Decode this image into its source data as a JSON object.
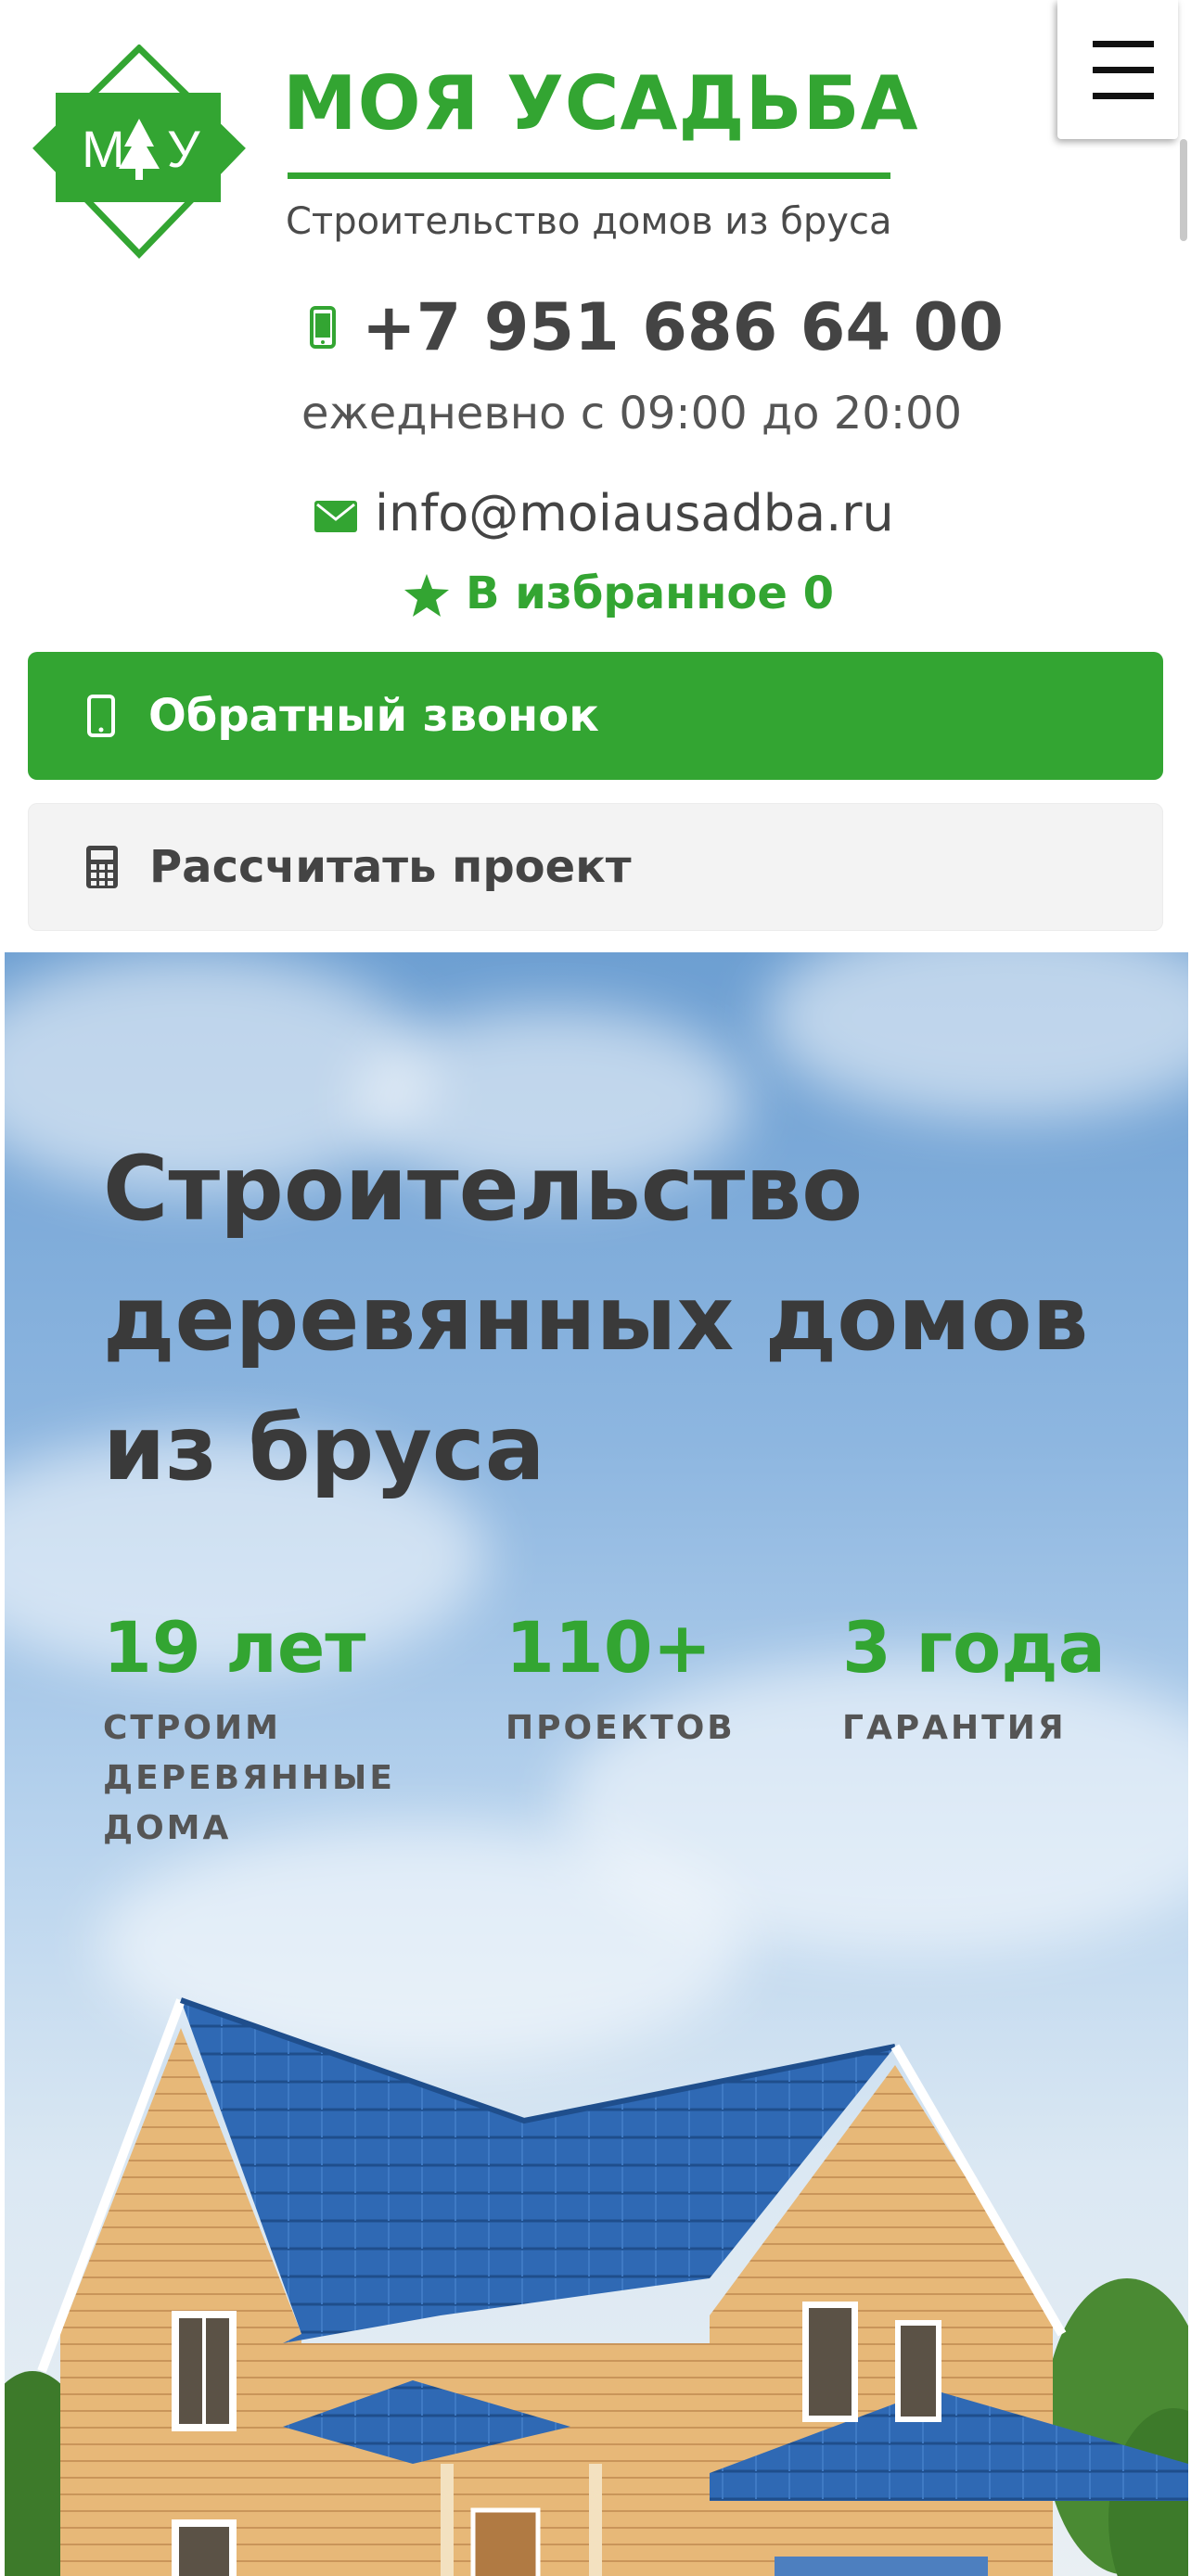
{
  "header": {
    "logo_letters": [
      "М",
      "У"
    ],
    "brand_name": "МОЯ УСАДЬБА",
    "brand_tagline": "Строительство домов из бруса",
    "menu_icon": "hamburger-icon"
  },
  "contacts": {
    "phone": "+7 951 686 64 00",
    "hours": "ежедневно с 09:00 до 20:00",
    "email": "info@moiausadba.ru",
    "favorites_label": "В избранное 0"
  },
  "buttons": {
    "callback": "Обратный звонок",
    "calculate": "Рассчитать проект"
  },
  "hero": {
    "title": "Строительство деревянных домов из бруса",
    "stats": [
      {
        "value": "19 лет",
        "label": "СТРОИМ ДЕРЕВЯННЫЕ ДОМА"
      },
      {
        "value": "110+",
        "label": "ПРОЕКТОВ"
      },
      {
        "value": "3 года",
        "label": "ГАРАНТИЯ"
      }
    ]
  },
  "colors": {
    "brand_green": "#33a532",
    "text_dark": "#444444",
    "button_secondary_bg": "#f3f3f3",
    "roof_blue": "#2f69b4"
  }
}
